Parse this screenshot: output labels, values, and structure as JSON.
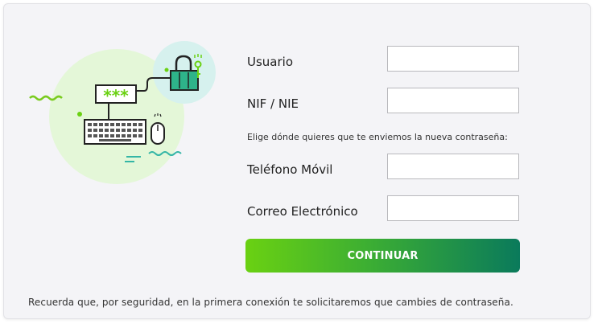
{
  "form": {
    "fields": [
      {
        "label": "Usuario",
        "value": "",
        "placeholder": ""
      },
      {
        "label": "NIF / NIE",
        "value": "",
        "placeholder": ""
      },
      {
        "label": "Teléfono Móvil",
        "value": "",
        "placeholder": ""
      },
      {
        "label": "Correo Electrónico",
        "value": "",
        "placeholder": ""
      }
    ],
    "helper_text": "Elige dónde quieres que te enviemos la nueva contraseña:",
    "continue_label": "CONTINUAR"
  },
  "illustration": {
    "password_mask": "***",
    "icons": [
      "padlock-icon",
      "key-icon",
      "keyboard-icon",
      "mouse-icon",
      "password-field-icon"
    ]
  },
  "footer": {
    "note": "Recuerda que, por seguridad, en la primera conexión te solicitaremos que cambies de contraseña."
  },
  "colors": {
    "accent_green": "#6ad112",
    "accent_teal": "#0a7a5b",
    "illustration_light_green": "#e4f7d8",
    "illustration_light_teal": "#d6f1ee",
    "padlock_fill": "#2eb38a"
  }
}
